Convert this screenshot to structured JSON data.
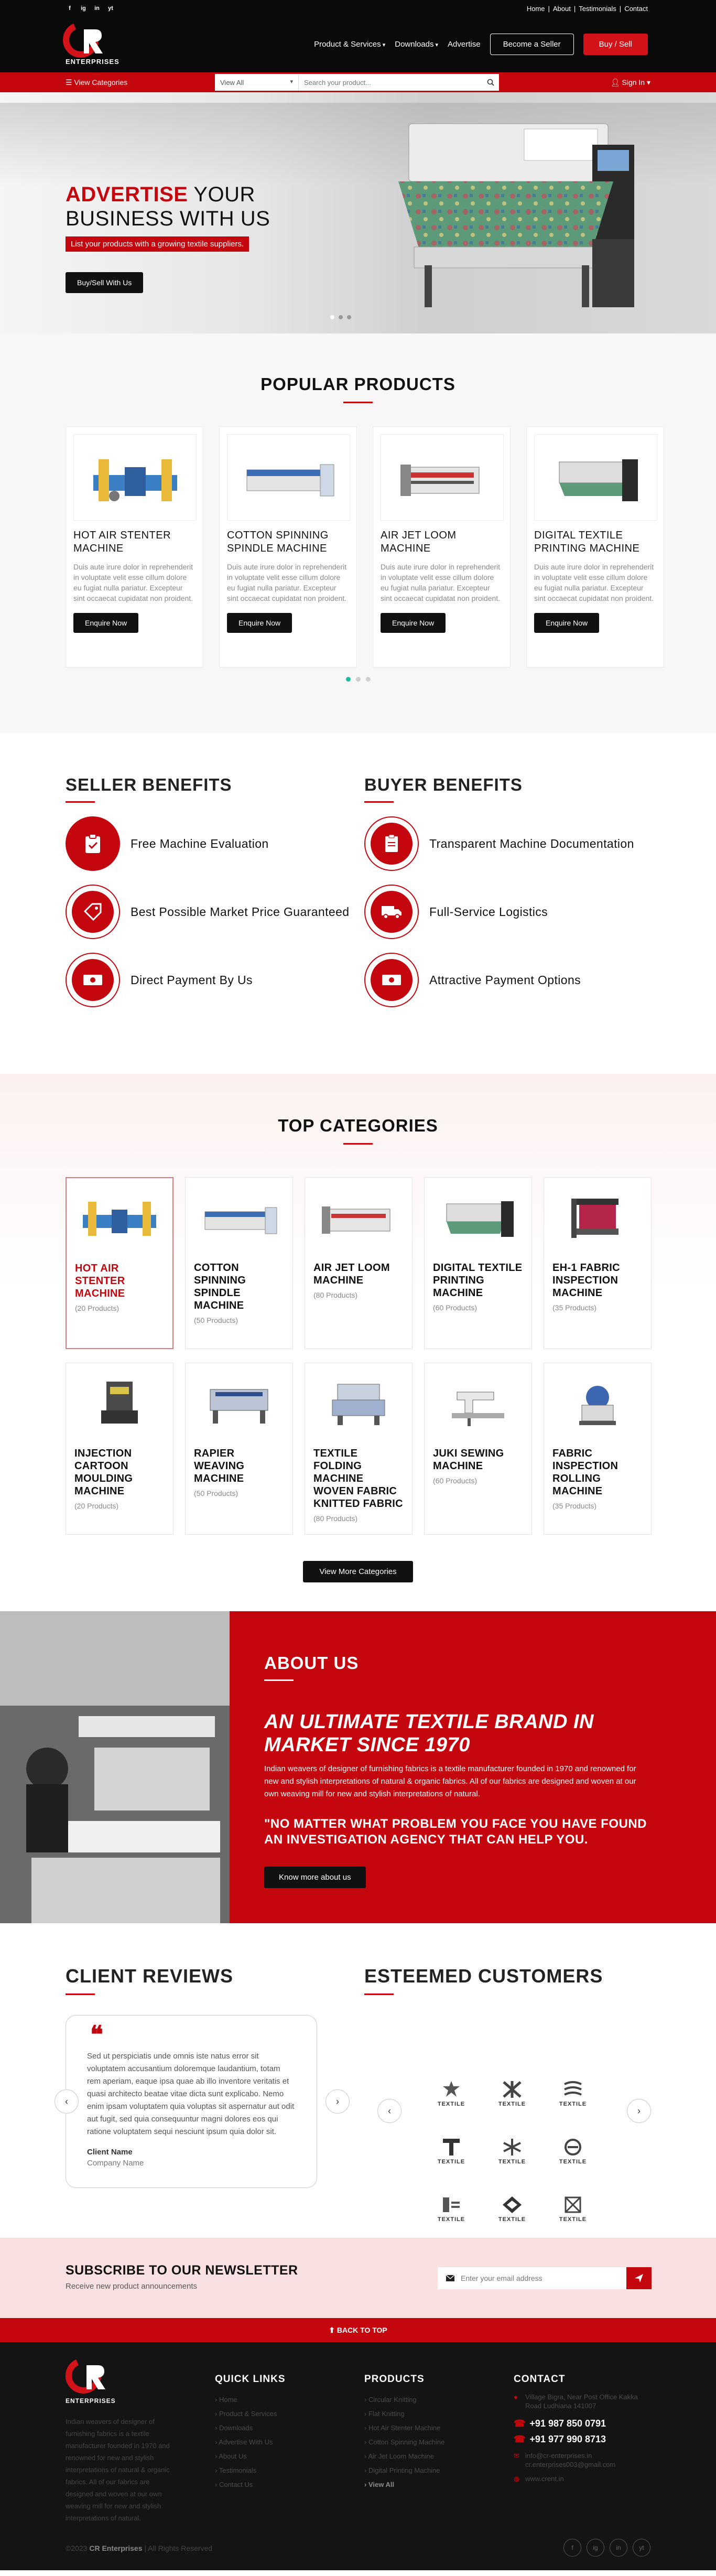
{
  "header": {
    "social": [
      "f",
      "ig",
      "in",
      "yt"
    ],
    "top_links": [
      "Home",
      "About",
      "Testimonials",
      "Contact"
    ],
    "logo_text": "ENTERPRISES",
    "logo_letters": "CR",
    "nav": [
      "Product & Services",
      "Downloads",
      "Advertise"
    ],
    "become_seller": "Become a Seller",
    "buy_sell": "Buy / Sell"
  },
  "searchbar": {
    "categories_link": "☰ View Categories",
    "select_value": "View All",
    "placeholder": "Search your product...",
    "signin": "Sign In"
  },
  "hero": {
    "title_highlight": "ADVERTISE",
    "title_rest1": " YOUR",
    "title_line2": "BUSINESS WITH US",
    "subtitle": "List your products with a growing textile suppliers.",
    "button": "Buy/Sell With Us"
  },
  "popular": {
    "title_light": "POPULAR",
    "title_bold": "PRODUCTS",
    "products": [
      {
        "name": "HOT AIR STENTER MACHINE",
        "desc": "Duis aute irure dolor in reprehenderit in voluptate velit esse cillum dolore eu fugiat nulla pariatur. Excepteur sint occaecat cupidatat non proident.",
        "button": "Enquire Now"
      },
      {
        "name": "COTTON SPINNING SPINDLE MACHINE",
        "desc": "Duis aute irure dolor in reprehenderit in voluptate velit esse cillum dolore eu fugiat nulla pariatur. Excepteur sint occaecat cupidatat non proident.",
        "button": "Enquire Now"
      },
      {
        "name": "AIR JET LOOM MACHINE",
        "desc": "Duis aute irure dolor in reprehenderit in voluptate velit esse cillum dolore eu fugiat nulla pariatur. Excepteur sint occaecat cupidatat non proident.",
        "button": "Enquire Now"
      },
      {
        "name": "DIGITAL TEXTILE PRINTING MACHINE",
        "desc": "Duis aute irure dolor in reprehenderit in voluptate velit esse cillum dolore eu fugiat nulla pariatur. Excepteur sint occaecat cupidatat non proident.",
        "button": "Enquire Now"
      }
    ]
  },
  "benefits": {
    "seller_title_bold": "SELLER",
    "seller_title_light": " BENEFITS",
    "buyer_title_bold": "BUYER",
    "buyer_title_light": " BENEFITS",
    "seller": [
      {
        "text": "Free Machine Evaluation",
        "icon": "clipboard-check-icon"
      },
      {
        "text": "Best Possible Market Price Guaranteed",
        "icon": "price-tag-icon"
      },
      {
        "text": "Direct Payment By Us",
        "icon": "money-icon"
      }
    ],
    "buyer": [
      {
        "text": "Transparent Machine Documentation",
        "icon": "document-icon"
      },
      {
        "text": "Full-Service Logistics",
        "icon": "truck-icon"
      },
      {
        "text": "Attractive Payment Options",
        "icon": "money-icon"
      }
    ]
  },
  "categories": {
    "title_light": "TOP",
    "title_bold": "CATEGORIES",
    "items": [
      {
        "name": "HOT AIR STENTER MACHINE",
        "count": "(20 Products)"
      },
      {
        "name": "COTTON SPINNING SPINDLE MACHINE",
        "count": "(50 Products)"
      },
      {
        "name": "AIR JET LOOM MACHINE",
        "count": "(80 Products)"
      },
      {
        "name": "DIGITAL TEXTILE PRINTING MACHINE",
        "count": "(60 Products)"
      },
      {
        "name": "EH-1 FABRIC INSPECTION MACHINE",
        "count": "(35 Products)"
      },
      {
        "name": "INJECTION CARTOON MOULDING MACHINE",
        "count": "(20 Products)"
      },
      {
        "name": "RAPIER WEAVING MACHINE",
        "count": "(50 Products)"
      },
      {
        "name": "TEXTILE FOLDING MACHINE WOVEN FABRIC KNITTED FABRIC",
        "count": "(80 Products)"
      },
      {
        "name": "JUKI SEWING MACHINE",
        "count": "(60 Products)"
      },
      {
        "name": "FABRIC INSPECTION ROLLING MACHINE",
        "count": "(35 Products)"
      }
    ],
    "more_button": "View More Categories"
  },
  "about": {
    "title_bold": "ABOUT",
    "title_light": " US",
    "heading": "AN ULTIMATE TEXTILE BRAND IN MARKET SINCE 1970",
    "paragraph": "Indian weavers of designer of furnishing fabrics is a textile manufacturer founded in 1970 and renowned for new and stylish interpretations of natural & organic fabrics. All of our fabrics are designed and woven at our own weaving mill for new and stylish interpretations of natural.",
    "quote": "\"NO MATTER WHAT PROBLEM YOU FACE YOU HAVE FOUND AN INVESTIGATION AGENCY THAT CAN HELP YOU.",
    "button": "Know more about us"
  },
  "reviews": {
    "title_light": "CLIENT",
    "title_bold": " REVIEWS",
    "quote_mark": "❝",
    "text": "Sed ut perspiciatis unde omnis iste natus error sit voluptatem accusantium doloremque laudantium, totam rem aperiam, eaque ipsa quae ab illo inventore veritatis et quasi architecto beatae vitae dicta sunt explicabo. Nemo enim ipsam voluptatem quia voluptas sit aspernatur aut odit aut fugit, sed quia consequuntur magni dolores eos qui ratione voluptatem sequi nesciunt ipsum quia dolor sit.",
    "client_name": "Client Name",
    "company": "Company Name",
    "prev": "‹",
    "next": "›"
  },
  "customers": {
    "title_light": "ESTEEMED",
    "title_bold": " CUSTOMERS",
    "logo_label": "TEXTILE",
    "prev": "‹",
    "next": "›"
  },
  "newsletter": {
    "title": "SUBSCRIBE TO OUR NEWSLETTER",
    "subtitle": "Receive new product announcements",
    "placeholder": "Enter your email address"
  },
  "backtop": "⬆ BACK TO TOP",
  "footer": {
    "about": "Indian weavers of designer of furnishing fabrics is a textile manufacturer founded in 1970 and renowned for new and stylish interpretations of natural & organic fabrics. All of our fabrics are designed and woven at our own weaving mill for new and stylish interpretations of natural.",
    "quick_links_title": "QUICK LINKS",
    "quick_links": [
      "Home",
      "Product & Services",
      "Downloads",
      "Advertise With Us",
      "About Us",
      "Testimonials",
      "Contact Us"
    ],
    "products_title": "PRODUCTS",
    "products": [
      "Circular Knitting",
      "Flat Knitting",
      "Hot Air Stenter Machine",
      "Cotton Spinning Machine",
      "Air Jet Loom Machine",
      "Digital Printing Machine"
    ],
    "products_more": "View All",
    "contact_title": "CONTACT",
    "address": "Village Bigra, Near Post Office Kakka Road Ludhiana 141007",
    "phone1": "+91 987 850 0791",
    "phone2": "+91 977 990 8713",
    "email": "info@cr-enterprises.in cr.enterprises003@gmail.com",
    "web": "www.crent.in",
    "copyright_pre": "©2023 ",
    "copyright_brand": "CR Enterprises",
    "copyright_post": " | All Rights Reserved",
    "social": [
      "f",
      "ig",
      "in",
      "yt"
    ]
  }
}
